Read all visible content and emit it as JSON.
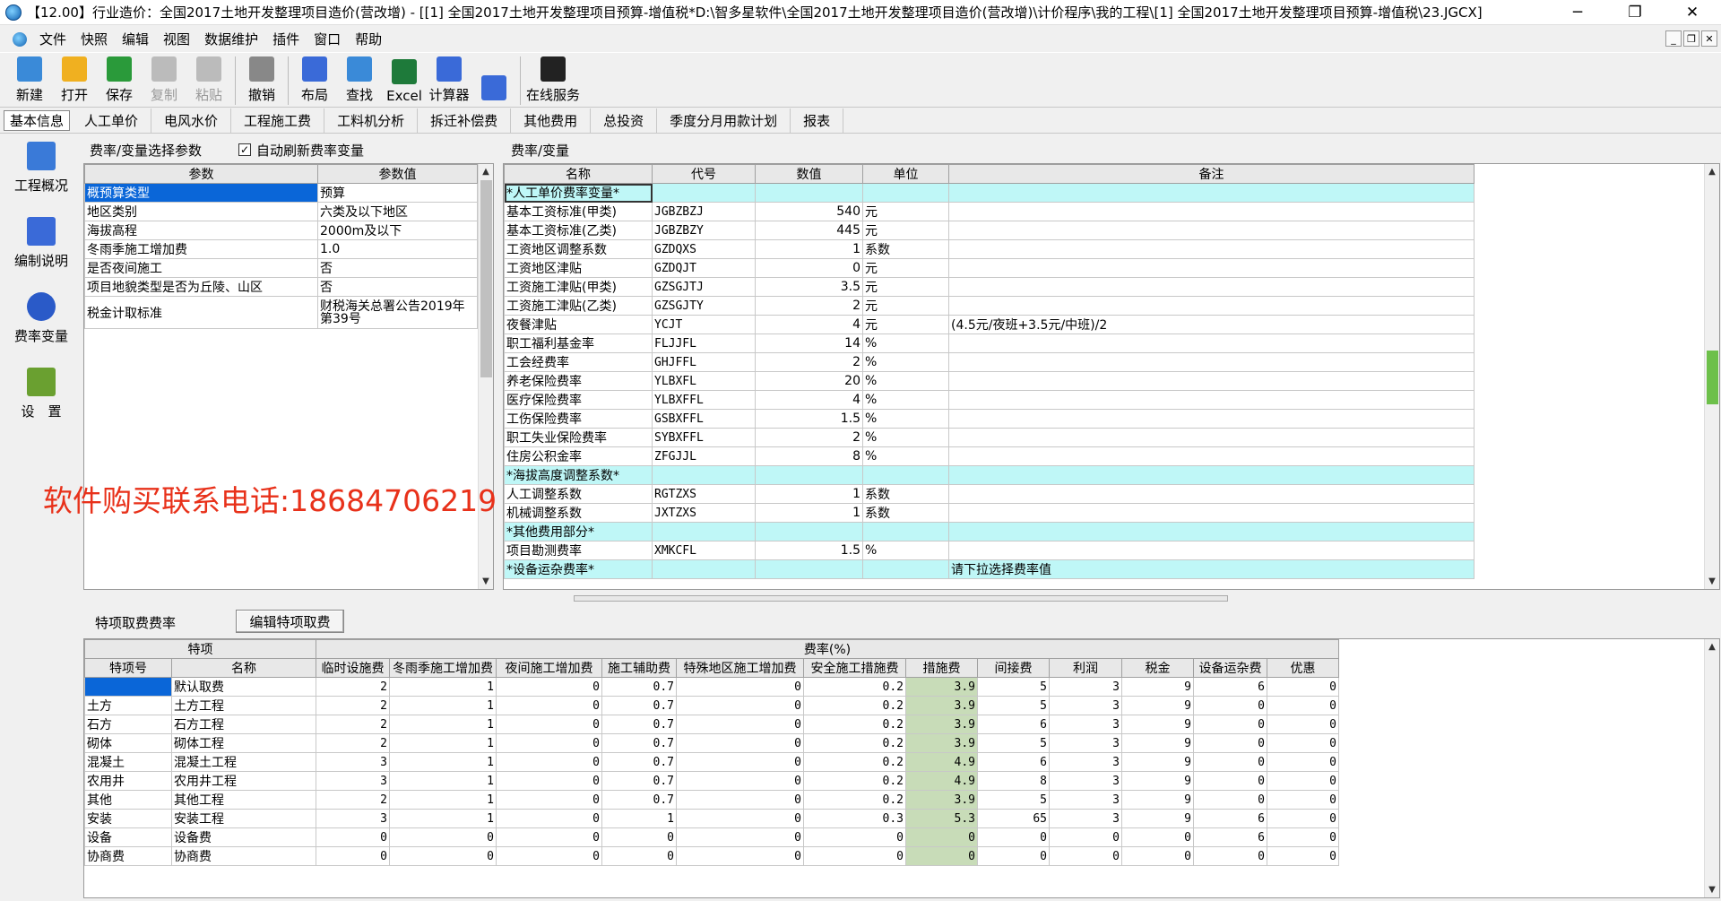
{
  "window": {
    "title": "【12.00】行业造价：全国2017土地开发整理项目造价(营改增) - [[1] 全国2017土地开发整理项目预算-增值税*D:\\智多星软件\\全国2017土地开发整理项目造价(营改增)\\计价程序\\我的工程\\[1] 全国2017土地开发整理项目预算-增值税\\23.JGCX]",
    "min": "─",
    "max": "❐",
    "close": "✕"
  },
  "menu": [
    "文件",
    "快照",
    "编辑",
    "视图",
    "数据维护",
    "插件",
    "窗口",
    "帮助"
  ],
  "toolbar": [
    {
      "label": "新建",
      "icon": "new-file-icon",
      "color": "#3a8ad8"
    },
    {
      "label": "打开",
      "icon": "open-folder-icon",
      "color": "#f0b020"
    },
    {
      "label": "保存",
      "icon": "save-disk-icon",
      "color": "#2a9a3a"
    },
    {
      "label": "复制",
      "icon": "copy-icon",
      "color": "#bbbbbb",
      "disabled": true
    },
    {
      "label": "粘贴",
      "icon": "paste-icon",
      "color": "#bbbbbb",
      "disabled": true
    },
    {
      "label": "撤销",
      "icon": "undo-icon",
      "color": "#888888"
    },
    {
      "label": "布局",
      "icon": "layout-grid-icon",
      "color": "#3a6ad8"
    },
    {
      "label": "查找",
      "icon": "find-icon",
      "color": "#3a8ad8"
    },
    {
      "label": "Excel",
      "icon": "excel-icon",
      "color": "#1e7a3a"
    },
    {
      "label": "计算器",
      "icon": "calculator-icon",
      "color": "#3a6ad8"
    },
    {
      "label": "",
      "icon": "tree-dropdown-icon",
      "color": "#3a6ad8"
    },
    {
      "label": "在线服务",
      "icon": "online-service-icon",
      "color": "#222222"
    }
  ],
  "tabs": [
    "基本信息",
    "人工单价",
    "电风水价",
    "工程施工费",
    "工料机分析",
    "拆迁补偿费",
    "其他费用",
    "总投资",
    "季度分月用款计划",
    "报表"
  ],
  "nav": [
    {
      "label": "工程概况",
      "icon": "project-overview-icon"
    },
    {
      "label": "编制说明",
      "icon": "edit-notes-icon"
    },
    {
      "label": "费率变量",
      "icon": "rate-variables-icon"
    },
    {
      "label": "设　置",
      "icon": "settings-icon"
    }
  ],
  "left_panel": {
    "title": "费率/变量选择参数",
    "auto_refresh": "自动刷新费率变量",
    "headers": [
      "参数",
      "参数值"
    ],
    "rows": [
      [
        "概预算类型",
        "预算"
      ],
      [
        "地区类别",
        "六类及以下地区"
      ],
      [
        "海拔高程",
        "2000m及以下"
      ],
      [
        "冬雨季施工增加费",
        "1.0"
      ],
      [
        "是否夜间施工",
        "否"
      ],
      [
        "项目地貌类型是否为丘陵、山区",
        "否"
      ],
      [
        "税金计取标准",
        "财税海关总署公告2019年第39号"
      ]
    ]
  },
  "watermark": "软件购买联系电话:18684706219",
  "right_panel": {
    "title": "费率/变量",
    "headers": [
      "名称",
      "代号",
      "数值",
      "单位",
      "备注"
    ],
    "rows": [
      {
        "c": [
          "*人工单价费率变量*",
          "",
          "",
          "",
          ""
        ],
        "section": true,
        "selected": true
      },
      {
        "c": [
          "基本工资标准(甲类)",
          "JGBZBZJ",
          "540",
          "元",
          ""
        ]
      },
      {
        "c": [
          "基本工资标准(乙类)",
          "JGBZBZY",
          "445",
          "元",
          ""
        ]
      },
      {
        "c": [
          "工资地区调整系数",
          "GZDQXS",
          "1",
          "系数",
          ""
        ]
      },
      {
        "c": [
          "工资地区津贴",
          "GZDQJT",
          "0",
          "元",
          ""
        ]
      },
      {
        "c": [
          "工资施工津贴(甲类)",
          "GZSGJTJ",
          "3.5",
          "元",
          ""
        ]
      },
      {
        "c": [
          "工资施工津贴(乙类)",
          "GZSGJTY",
          "2",
          "元",
          ""
        ]
      },
      {
        "c": [
          "夜餐津贴",
          "YCJT",
          "4",
          "元",
          "(4.5元/夜班+3.5元/中班)/2"
        ]
      },
      {
        "c": [
          "职工福利基金率",
          "FLJJFL",
          "14",
          "%",
          ""
        ]
      },
      {
        "c": [
          "工会经费率",
          "GHJFFL",
          "2",
          "%",
          ""
        ]
      },
      {
        "c": [
          "养老保险费率",
          "YLBXFL",
          "20",
          "%",
          ""
        ]
      },
      {
        "c": [
          "医疗保险费率",
          "YLBXFFL",
          "4",
          "%",
          ""
        ]
      },
      {
        "c": [
          "工伤保险费率",
          "GSBXFFL",
          "1.5",
          "%",
          ""
        ]
      },
      {
        "c": [
          "职工失业保险费率",
          "SYBXFFL",
          "2",
          "%",
          ""
        ]
      },
      {
        "c": [
          "住房公积金率",
          "ZFGJJL",
          "8",
          "%",
          ""
        ]
      },
      {
        "c": [
          "*海拔高度调整系数*",
          "",
          "",
          "",
          ""
        ],
        "section": true
      },
      {
        "c": [
          "人工调整系数",
          "RGTZXS",
          "1",
          "系数",
          ""
        ]
      },
      {
        "c": [
          "机械调整系数",
          "JXTZXS",
          "1",
          "系数",
          ""
        ]
      },
      {
        "c": [
          "*其他费用部分*",
          "",
          "",
          "",
          ""
        ],
        "section": true
      },
      {
        "c": [
          "项目勘测费率",
          "XMKCFL",
          "1.5",
          "%",
          ""
        ]
      },
      {
        "c": [
          "*设备运杂费率*",
          "",
          "",
          "",
          "请下拉选择费率值"
        ],
        "section": true
      }
    ]
  },
  "bottom_panel": {
    "title": "特项取费费率",
    "edit_button": "编辑特项取费",
    "group_headers": [
      "特项",
      "费率(%)"
    ],
    "headers": [
      "特项号",
      "名称",
      "临时设施费",
      "冬雨季施工增加费",
      "夜间施工增加费",
      "施工辅助费",
      "特殊地区施工增加费",
      "安全施工措施费",
      "措施费",
      "间接费",
      "利润",
      "税金",
      "设备运杂费",
      "优惠"
    ],
    "rows": [
      [
        "",
        "默认取费",
        "2",
        "1",
        "0",
        "0.7",
        "0",
        "0.2",
        "3.9",
        "5",
        "3",
        "9",
        "6",
        "0"
      ],
      [
        "土方",
        "土方工程",
        "2",
        "1",
        "0",
        "0.7",
        "0",
        "0.2",
        "3.9",
        "5",
        "3",
        "9",
        "0",
        "0"
      ],
      [
        "石方",
        "石方工程",
        "2",
        "1",
        "0",
        "0.7",
        "0",
        "0.2",
        "3.9",
        "6",
        "3",
        "9",
        "0",
        "0"
      ],
      [
        "砌体",
        "砌体工程",
        "2",
        "1",
        "0",
        "0.7",
        "0",
        "0.2",
        "3.9",
        "5",
        "3",
        "9",
        "0",
        "0"
      ],
      [
        "混凝土",
        "混凝土工程",
        "3",
        "1",
        "0",
        "0.7",
        "0",
        "0.2",
        "4.9",
        "6",
        "3",
        "9",
        "0",
        "0"
      ],
      [
        "农用井",
        "农用井工程",
        "3",
        "1",
        "0",
        "0.7",
        "0",
        "0.2",
        "4.9",
        "8",
        "3",
        "9",
        "0",
        "0"
      ],
      [
        "其他",
        "其他工程",
        "2",
        "1",
        "0",
        "0.7",
        "0",
        "0.2",
        "3.9",
        "5",
        "3",
        "9",
        "0",
        "0"
      ],
      [
        "安装",
        "安装工程",
        "3",
        "1",
        "0",
        "1",
        "0",
        "0.3",
        "5.3",
        "65",
        "3",
        "9",
        "6",
        "0"
      ],
      [
        "设备",
        "设备费",
        "0",
        "0",
        "0",
        "0",
        "0",
        "0",
        "0",
        "0",
        "0",
        "0",
        "6",
        "0"
      ],
      [
        "协商费",
        "协商费",
        "0",
        "0",
        "0",
        "0",
        "0",
        "0",
        "0",
        "0",
        "0",
        "0",
        "0",
        "0"
      ]
    ]
  }
}
